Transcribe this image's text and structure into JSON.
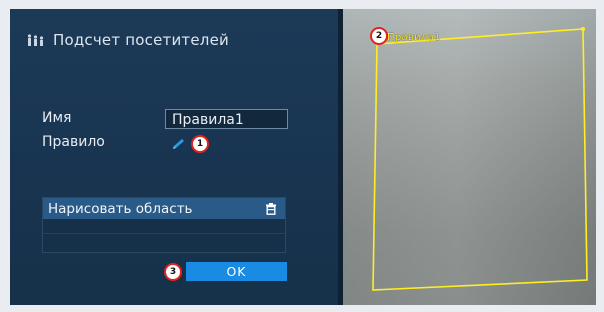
{
  "panel": {
    "title": "Подсчет посетителей",
    "title_icon": "people-counting-icon",
    "name_label": "Имя",
    "name_value": "Правила1",
    "rule_label": "Правило",
    "rule_edit_icon": "pencil-icon"
  },
  "draw_area": {
    "header": "Нарисовать область",
    "delete_icon": "trash-icon"
  },
  "ok_button": "OK",
  "video": {
    "zone_label": "Правила1",
    "zone_color": "#ffee22"
  },
  "annotations": {
    "badge_1": "1",
    "badge_2": "2",
    "badge_3": "3",
    "badge_color": "#e0241b"
  },
  "colors": {
    "panel_bg": "#1c3a57",
    "accent": "#1a8be2",
    "header_bg": "#2a5a88"
  }
}
